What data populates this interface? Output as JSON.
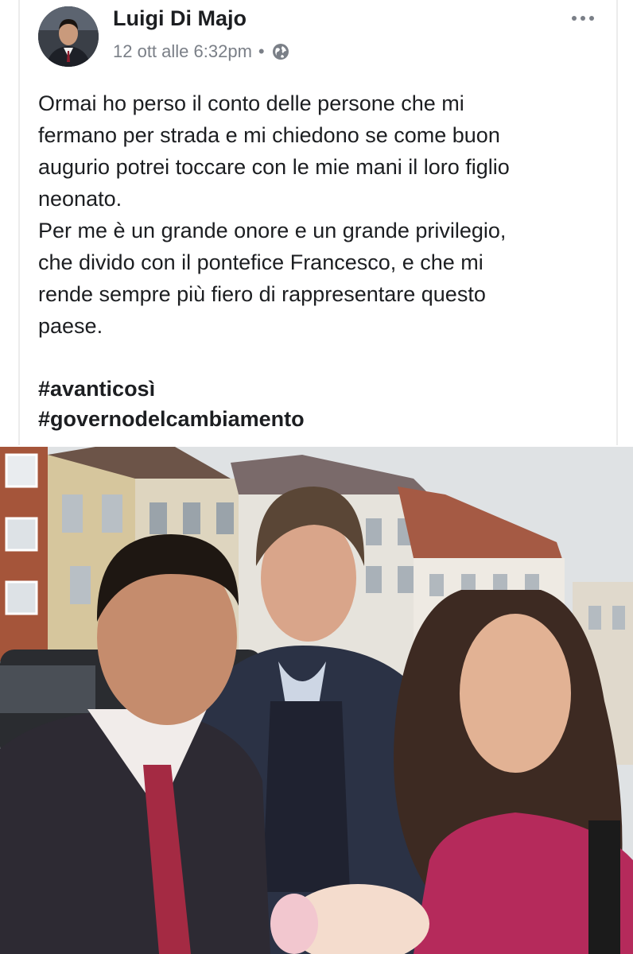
{
  "post": {
    "author": "Luigi Di Majo",
    "timestamp": "12 ott alle 6:32pm",
    "separator": "•",
    "privacy_icon": "globe-icon",
    "more_icon": "more-options-icon",
    "body_lines": [
      "Ormai ho perso il conto delle persone che mi",
      "fermano per strada e mi chiedono se come buon",
      "augurio potrei toccare con le mie mani il loro figlio",
      "neonato.",
      "Per me è un grande onore e un grande privilegio,",
      "che divido con il pontefice Francesco, e che mi",
      "rende sempre più fiero di rappresentare questo",
      "paese."
    ],
    "hashtags": [
      "#avanticosì",
      "#governodelcambiamento"
    ]
  },
  "colors": {
    "text": "#1c1e21",
    "meta": "#7a7f87",
    "background": "#ffffff"
  }
}
